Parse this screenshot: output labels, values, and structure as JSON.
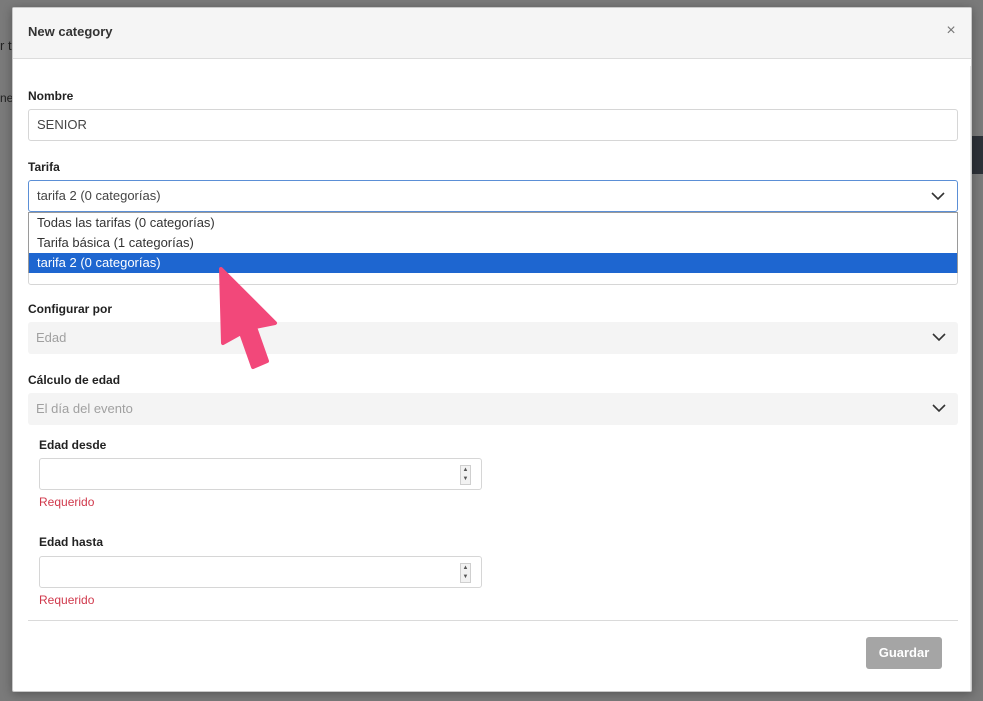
{
  "backdrop": {
    "fragment_1": "r t",
    "fragment_2": "ne"
  },
  "modal": {
    "title": "New category",
    "close_glyph": "×"
  },
  "form": {
    "nombre": {
      "label": "Nombre",
      "value": "SENIOR"
    },
    "tarifa": {
      "label": "Tarifa",
      "selected": "tarifa 2 (0 categorías)",
      "options": [
        "Todas las tarifas (0 categorías)",
        "Tarifa básica (1 categorías)",
        "tarifa 2 (0 categorías)"
      ],
      "selected_index": 2
    },
    "configurar_por": {
      "label": "Configurar por",
      "value": "Edad"
    },
    "calculo_edad": {
      "label": "Cálculo de edad",
      "value": "El día del evento"
    },
    "edad_desde": {
      "label": "Edad desde",
      "value": "",
      "error": "Requerido"
    },
    "edad_hasta": {
      "label": "Edad hasta",
      "value": "",
      "error": "Requerido"
    }
  },
  "footer": {
    "save_label": "Guardar"
  },
  "icons": {
    "chevron": "chevron-down-icon",
    "cursor": "pointer-arrow-icon",
    "cursor_color": "#f2487a"
  }
}
